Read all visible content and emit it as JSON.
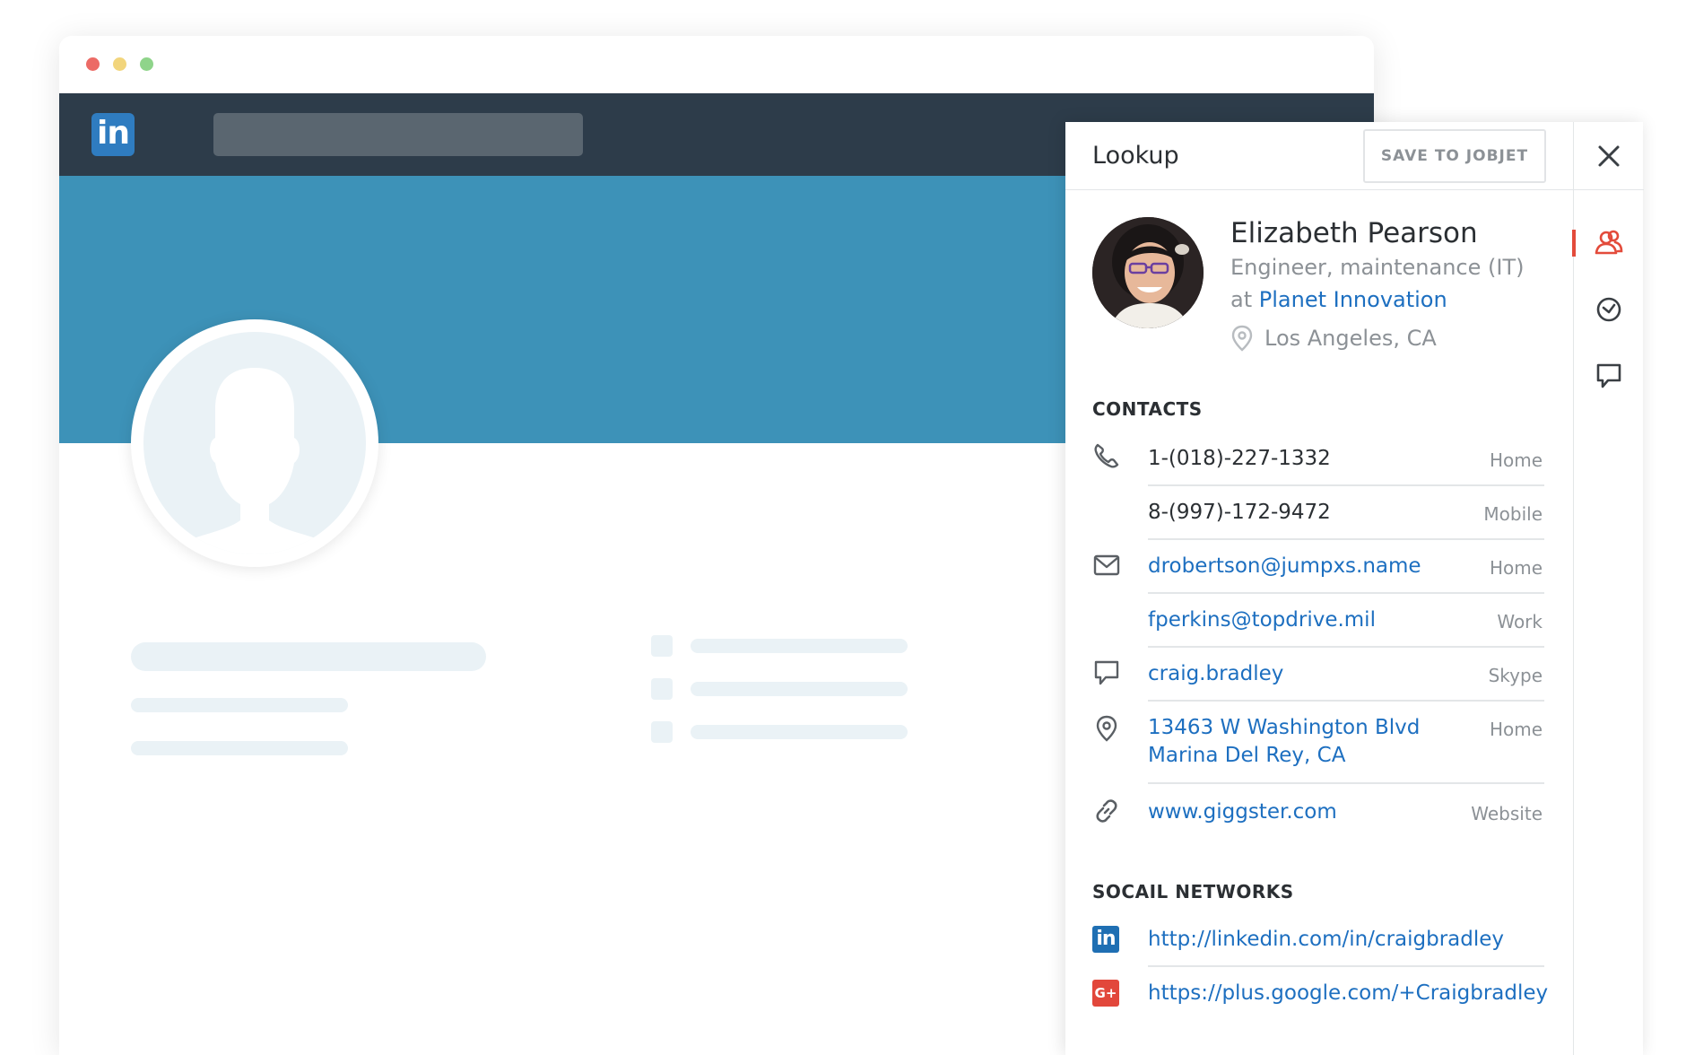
{
  "panel": {
    "title": "Lookup",
    "save_button": "SAVE TO JOBJET",
    "close_icon": "close-icon",
    "rail_icons": [
      "contacts-icon",
      "history-icon",
      "chat-icon"
    ],
    "accent_color": "#e34b3b"
  },
  "person": {
    "name": "Elizabeth Pearson",
    "role": "Engineer, maintenance (IT)",
    "at": "at",
    "company": "Planet Innovation",
    "location": "Los Angeles, CA"
  },
  "contacts": {
    "title": "CONTACTS",
    "phones": [
      {
        "value": "1-(018)-227-1332",
        "label": "Home"
      },
      {
        "value": "8-(997)-172-9472",
        "label": "Mobile"
      }
    ],
    "emails": [
      {
        "value": "drobertson@jumpxs.name",
        "label": "Home"
      },
      {
        "value": "fperkins@topdrive.mil",
        "label": "Work"
      }
    ],
    "skype": {
      "value": "craig.bradley",
      "label": "Skype"
    },
    "address": {
      "line1": "13463 W Washington Blvd",
      "line2": "Marina Del Rey, CA",
      "label": "Home"
    },
    "website": {
      "value": "www.giggster.com",
      "label": "Website"
    }
  },
  "social": {
    "title": "SOCAIL NETWORKS",
    "linkedin": {
      "icon_text": "in",
      "value": "http://linkedin.com/in/craigbradley"
    },
    "google": {
      "icon_text": "G+",
      "value": "https://plus.google.com/+Craigbradley"
    }
  },
  "browser": {
    "logo_text": "in",
    "brand_color": "#2d3c4a",
    "cover_color": "#3d92b8"
  }
}
